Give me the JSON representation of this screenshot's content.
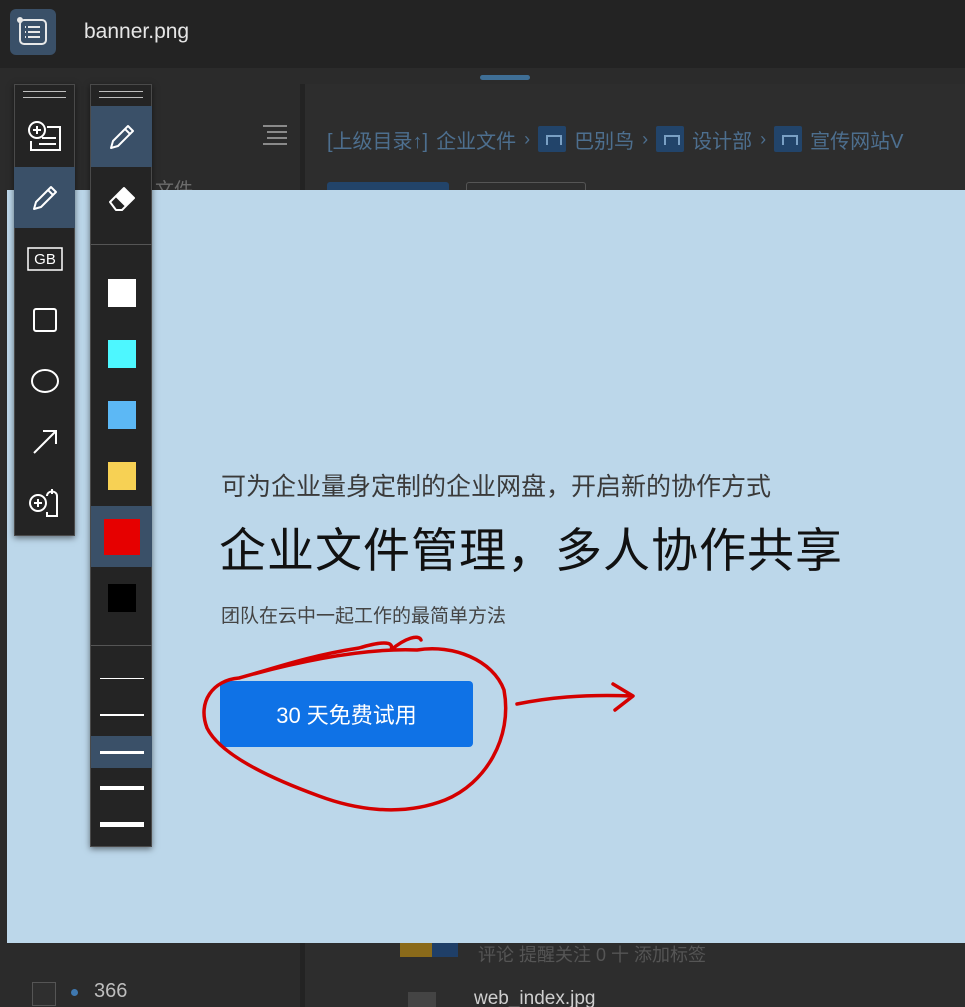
{
  "window": {
    "filename": "banner.png"
  },
  "background": {
    "sidebar_text": "文件",
    "breadcrumbs": [
      {
        "label": "[上级目录↑]",
        "icon": null
      },
      {
        "label": "企业文件",
        "icon": null
      },
      {
        "label": "巴别鸟",
        "icon": "org-icon"
      },
      {
        "label": "设计部",
        "icon": "org-icon"
      },
      {
        "label": "宣传网站V",
        "icon": "share-icon"
      }
    ],
    "row_actions": "评论  提醒关注 0  十 添加标签",
    "count": "366",
    "row_filename": "web_index.jpg"
  },
  "banner": {
    "subtitle": "可为企业量身定制的企业网盘，开启新的协作方式",
    "title": "企业文件管理，多人协作共享",
    "tagline": "团队在云中一起工作的最简单方法",
    "cta_label": "30 天免费试用",
    "annotation_color": "#d40000"
  },
  "tools": {
    "left": [
      {
        "name": "add-text-tool",
        "icon": "add-text-icon",
        "active": false
      },
      {
        "name": "pen-tool",
        "icon": "pencil-icon",
        "active": true
      },
      {
        "name": "mosaic-tool",
        "icon": "gb-icon",
        "label": "GB",
        "active": false
      },
      {
        "name": "rectangle-tool",
        "icon": "square-icon",
        "active": false
      },
      {
        "name": "ellipse-tool",
        "icon": "circle-icon",
        "active": false
      },
      {
        "name": "arrow-tool",
        "icon": "arrow-icon",
        "active": false
      },
      {
        "name": "add-sticker-tool",
        "icon": "add-bubble-icon",
        "active": false
      }
    ],
    "right": {
      "modes": [
        {
          "name": "pencil-mode",
          "icon": "pencil-icon",
          "active": true
        },
        {
          "name": "eraser-mode",
          "icon": "eraser-icon",
          "active": false
        }
      ],
      "colors": [
        {
          "hex": "#ffffff",
          "active": false
        },
        {
          "hex": "#4df7ff",
          "active": false
        },
        {
          "hex": "#5cb8f5",
          "active": false
        },
        {
          "hex": "#f7d154",
          "active": false
        },
        {
          "hex": "#e60000",
          "active": true
        },
        {
          "hex": "#000000",
          "active": false
        }
      ],
      "line_widths": [
        {
          "value": 1,
          "active": false
        },
        {
          "value": 2,
          "active": false
        },
        {
          "value": 3,
          "active": true
        },
        {
          "value": 4,
          "active": false
        },
        {
          "value": 5,
          "active": false
        }
      ]
    }
  }
}
